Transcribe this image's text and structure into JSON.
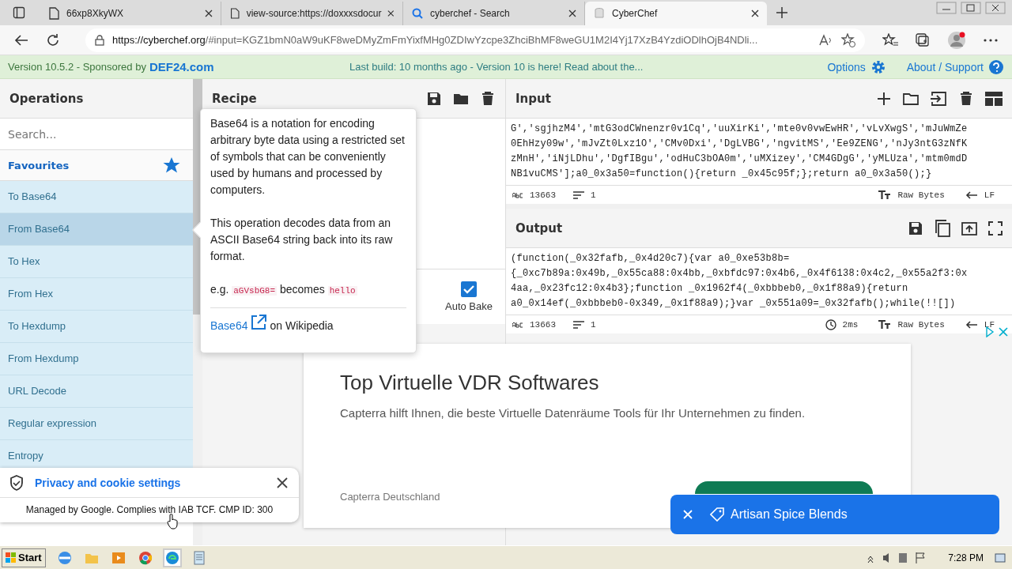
{
  "browser": {
    "tabs": [
      {
        "title": "66xp8XkyWX",
        "kind": "page",
        "selected": false
      },
      {
        "title": "view-source:https://doxxxsdocur",
        "kind": "page",
        "selected": false
      },
      {
        "title": "cyberchef - Search",
        "kind": "search",
        "selected": false
      },
      {
        "title": "CyberChef",
        "kind": "app",
        "selected": true
      }
    ],
    "url_host": "https://cyberchef.org",
    "url_rest": "/#input=KGZ1bmN0aW9uKF8weDMyZmFmYixfMHg0ZDIwYzcpe3ZhciBhMF8weGU1M2I4Yj17XzB4YzdiODlhOjB4NDli..."
  },
  "banner": {
    "version": "Version 10.5.2 - Sponsored by",
    "sponsor": "DEF24.com",
    "build": "Last build: 10 months ago - Version 10 is here! Read about the...",
    "options": "Options",
    "about": "About / Support"
  },
  "operations": {
    "title": "Operations",
    "search_placeholder": "Search...",
    "favourites": "Favourites",
    "items": [
      {
        "label": "To Base64",
        "selected": false
      },
      {
        "label": "From Base64",
        "selected": true
      },
      {
        "label": "To Hex",
        "selected": false
      },
      {
        "label": "From Hex",
        "selected": false
      },
      {
        "label": "To Hexdump",
        "selected": false
      },
      {
        "label": "From Hexdump",
        "selected": false
      },
      {
        "label": "URL Decode",
        "selected": false
      },
      {
        "label": "Regular expression",
        "selected": false
      },
      {
        "label": "Entropy",
        "selected": false
      }
    ]
  },
  "recipe": {
    "title": "Recipe",
    "auto_bake": {
      "label": "Auto Bake",
      "checked": true
    }
  },
  "popover": {
    "paragraphs": [
      "Base64 is a notation for encoding arbitrary byte data using a restricted set of symbols that can be conveniently used by humans and processed by computers.",
      "This operation decodes data from an ASCII Base64 string back into its raw format."
    ],
    "example": {
      "prefix": "e.g.",
      "input": "aGVsbG8=",
      "middle": "becomes",
      "output": "hello"
    },
    "link": "Base64",
    "link_suffix": "on Wikipedia"
  },
  "input": {
    "title": "Input",
    "lines": [
      "G','sgjhzM4','mtG3odCWnenzr0v1Cq','uuXirKi','mte0v0vwEwHR','vLvXwgS','mJuWmZe",
      "0EhHzy09w','mJvZt0Lxz1O','CMv0Dxi','DgLVBG','ngvitMS','Ee9ZENG','nJy3ntG3zNfK",
      "zMnH','iNjLDhu','DgfIBgu','odHuC3bOA0m','uMXizey','CM4GDgG','yMLUza','mtm0mdD",
      "NB1vuCMS'];a0_0x3a50=function(){return _0x45c95f;};return a0_0x3a50();}"
    ],
    "chars": "13663",
    "line_count": "1",
    "format": "Raw Bytes",
    "eol": "LF"
  },
  "output": {
    "title": "Output",
    "lines": [
      "(function(_0x32fafb,_0x4d20c7){var a0_0xe53b8b=",
      "{_0xc7b89a:0x49b,_0x55ca88:0x4bb,_0xbfdc97:0x4b6,_0x4f6138:0x4c2,_0x55a2f3:0x",
      "4aa,_0x23fc12:0x4b3};function _0x1962f4(_0xbbbeb0,_0x1f88a9){return",
      "a0_0x14ef(_0xbbbeb0-0x349,_0x1f88a9);}var _0x551a09=_0x32fafb();while(!![])"
    ],
    "chars": "13663",
    "line_count": "1",
    "time": "2ms",
    "format": "Raw Bytes",
    "eol": "LF"
  },
  "ad": {
    "title": "Top Virtuelle VDR Softwares",
    "text": "Capterra hilft Ihnen, die beste Virtuelle Datenräume Tools für Ihr Unternehmen zu finden.",
    "advertiser": "Capterra Deutschland"
  },
  "toast": {
    "label": "Artisan Spice Blends"
  },
  "privacy": {
    "title": "Privacy and cookie settings",
    "text": "Managed by Google. Complies with IAB TCF. CMP ID: 300"
  },
  "taskbar": {
    "start": "Start",
    "time": "7:28 PM"
  }
}
